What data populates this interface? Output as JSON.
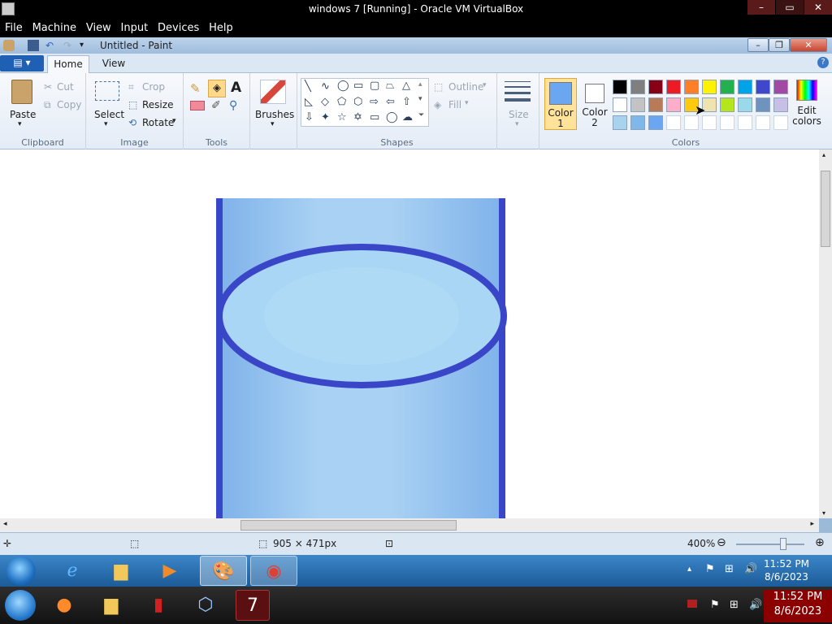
{
  "vbox": {
    "title": "windows 7 [Running] - Oracle VM VirtualBox",
    "menu": [
      "File",
      "Machine",
      "View",
      "Input",
      "Devices",
      "Help"
    ]
  },
  "paint": {
    "title": "Untitled - Paint",
    "tabs": {
      "home": "Home",
      "view": "View"
    },
    "clipboard": {
      "paste": "Paste",
      "cut": "Cut",
      "copy": "Copy",
      "label": "Clipboard"
    },
    "image": {
      "select": "Select",
      "crop": "Crop",
      "resize": "Resize",
      "rotate": "Rotate",
      "label": "Image"
    },
    "tools": {
      "label": "Tools"
    },
    "brushes": "Brushes",
    "shapes": {
      "outline": "Outline",
      "fill": "Fill",
      "label": "Shapes"
    },
    "size": "Size",
    "colors": {
      "color1": "Color 1",
      "color2": "Color 2",
      "edit": "Edit colors",
      "label": "Colors",
      "color1_value": "#6aa7f0",
      "color2_value": "#ffffff",
      "row1": [
        "#000000",
        "#7f7f7f",
        "#880015",
        "#ed1c24",
        "#ff7f27",
        "#fff200",
        "#22b14c",
        "#00a2e8",
        "#3f48cc",
        "#a349a4"
      ],
      "row2": [
        "#ffffff",
        "#c3c3c3",
        "#b97a57",
        "#ffaec9",
        "#ffc90e",
        "#efe4b0",
        "#b5e61d",
        "#99d9ea",
        "#7092be",
        "#c8bfe7"
      ],
      "row3": [
        "#a9d2ef",
        "#7fb7e8",
        "#6aa7f0",
        "#ffffff",
        "#ffffff",
        "#ffffff",
        "#ffffff",
        "#ffffff",
        "#ffffff",
        "#ffffff"
      ]
    },
    "status": {
      "dimensions": "905 × 471px",
      "zoom": "400%"
    }
  },
  "guest_clock": {
    "time": "11:52 PM",
    "date": "8/6/2023"
  },
  "host_clock": {
    "time": "11:52 PM",
    "date": "8/6/2023"
  }
}
